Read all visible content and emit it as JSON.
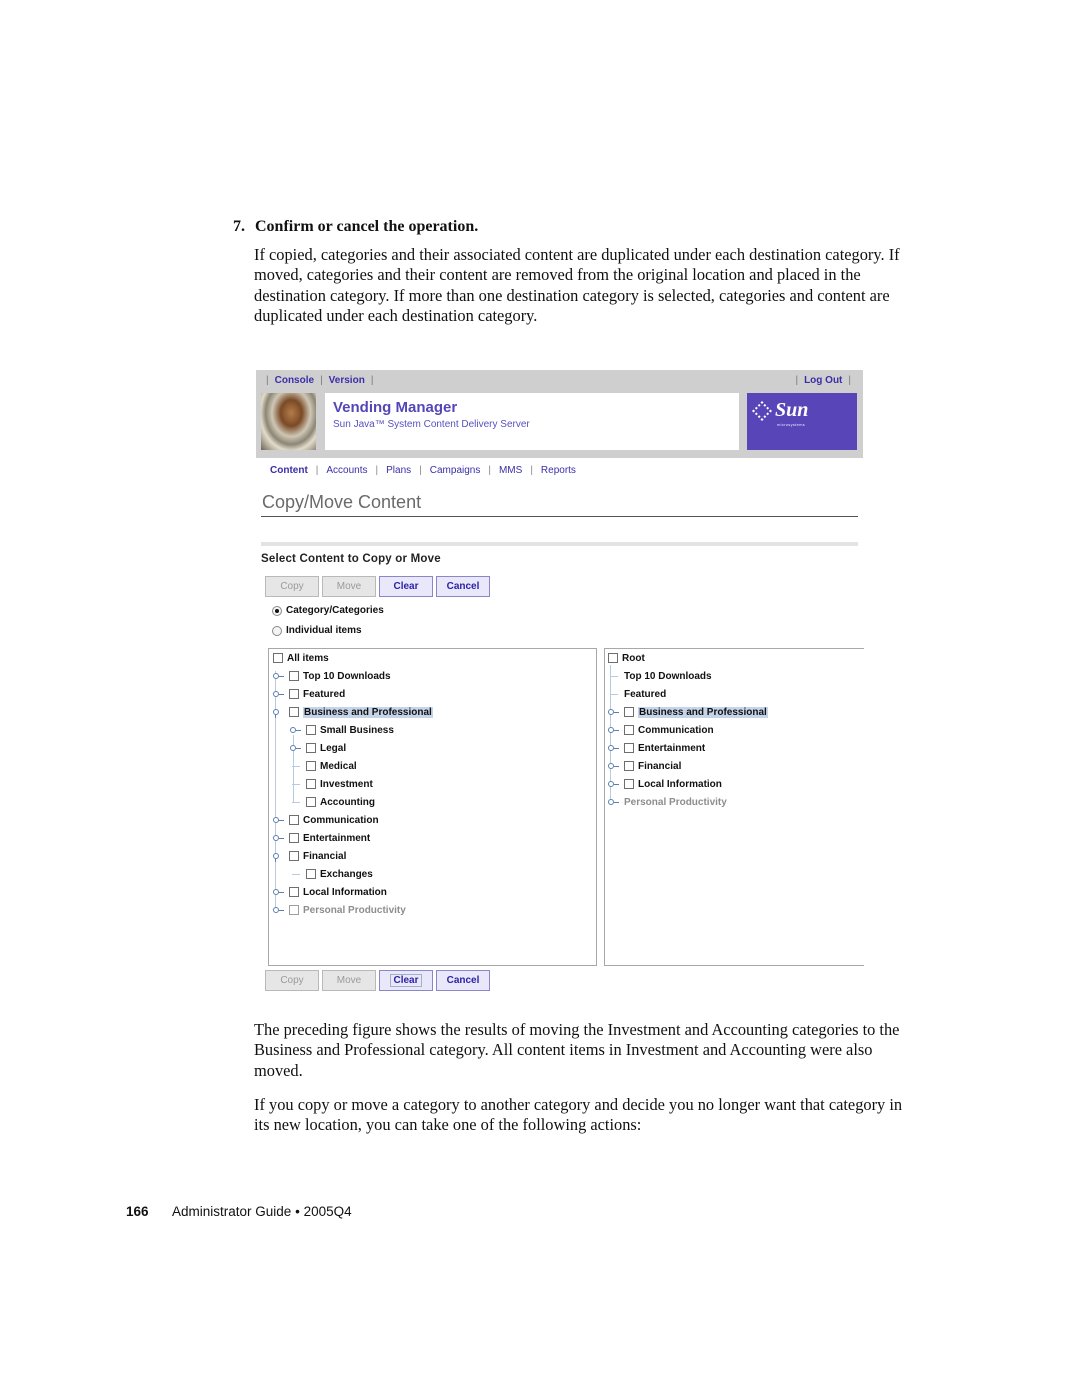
{
  "document": {
    "step_number": "7.",
    "step_heading": "Confirm or cancel the operation.",
    "para1": "If copied, categories and their associated content are duplicated under each destination category. If moved, categories and their content are removed from the original location and placed in the destination category. If more than one destination category is selected, categories and content are duplicated under each destination category.",
    "para2": "The preceding figure shows the results of moving the Investment and Accounting categories to the Business and Professional category. All content items in Investment and Accounting were also moved.",
    "para3": "If you copy or move a category to another category and decide you no longer want that category in its new location, you can take one of the following actions:",
    "footer": {
      "page_number": "166",
      "title": "Administrator Guide",
      "bullet": "•",
      "edition": "2005Q4"
    }
  },
  "app": {
    "masthead": {
      "links": [
        "Console",
        "Version"
      ],
      "logout": "Log Out",
      "product_title": "Vending Manager",
      "product_subtitle": "Sun Java™ System Content Delivery Server",
      "logo_text": "Sun",
      "logo_sub": "microsystems",
      "brand_color": "#5846b8"
    },
    "nav": {
      "items": [
        "Content",
        "Accounts",
        "Plans",
        "Campaigns",
        "MMS",
        "Reports"
      ],
      "active": "Content"
    },
    "page_title": "Copy/Move Content",
    "section_title": "Select Content to Copy or Move",
    "buttons": {
      "copy": "Copy",
      "move": "Move",
      "clear": "Clear",
      "cancel": "Cancel"
    },
    "radio_options": [
      {
        "label": "Category/Categories",
        "checked": true
      },
      {
        "label": "Individual items",
        "checked": false
      }
    ],
    "source_tree": [
      {
        "label": "All items"
      },
      {
        "label": "Top 10 Downloads"
      },
      {
        "label": "Featured"
      },
      {
        "label": "Business and Professional",
        "selected": true,
        "expanded": true
      },
      {
        "label": "Small Business"
      },
      {
        "label": "Legal"
      },
      {
        "label": "Medical"
      },
      {
        "label": "Investment"
      },
      {
        "label": "Accounting"
      },
      {
        "label": "Communication"
      },
      {
        "label": "Entertainment"
      },
      {
        "label": "Financial",
        "expanded": true
      },
      {
        "label": "Exchanges"
      },
      {
        "label": "Local Information"
      },
      {
        "label": "Personal Productivity",
        "disabled": true
      }
    ],
    "destination_tree": [
      {
        "label": "Root"
      },
      {
        "label": "Top 10 Downloads"
      },
      {
        "label": "Featured"
      },
      {
        "label": "Business and Professional",
        "selected": true
      },
      {
        "label": "Communication"
      },
      {
        "label": "Entertainment"
      },
      {
        "label": "Financial"
      },
      {
        "label": "Local Information"
      },
      {
        "label": "Personal Productivity",
        "disabled": true
      }
    ]
  }
}
